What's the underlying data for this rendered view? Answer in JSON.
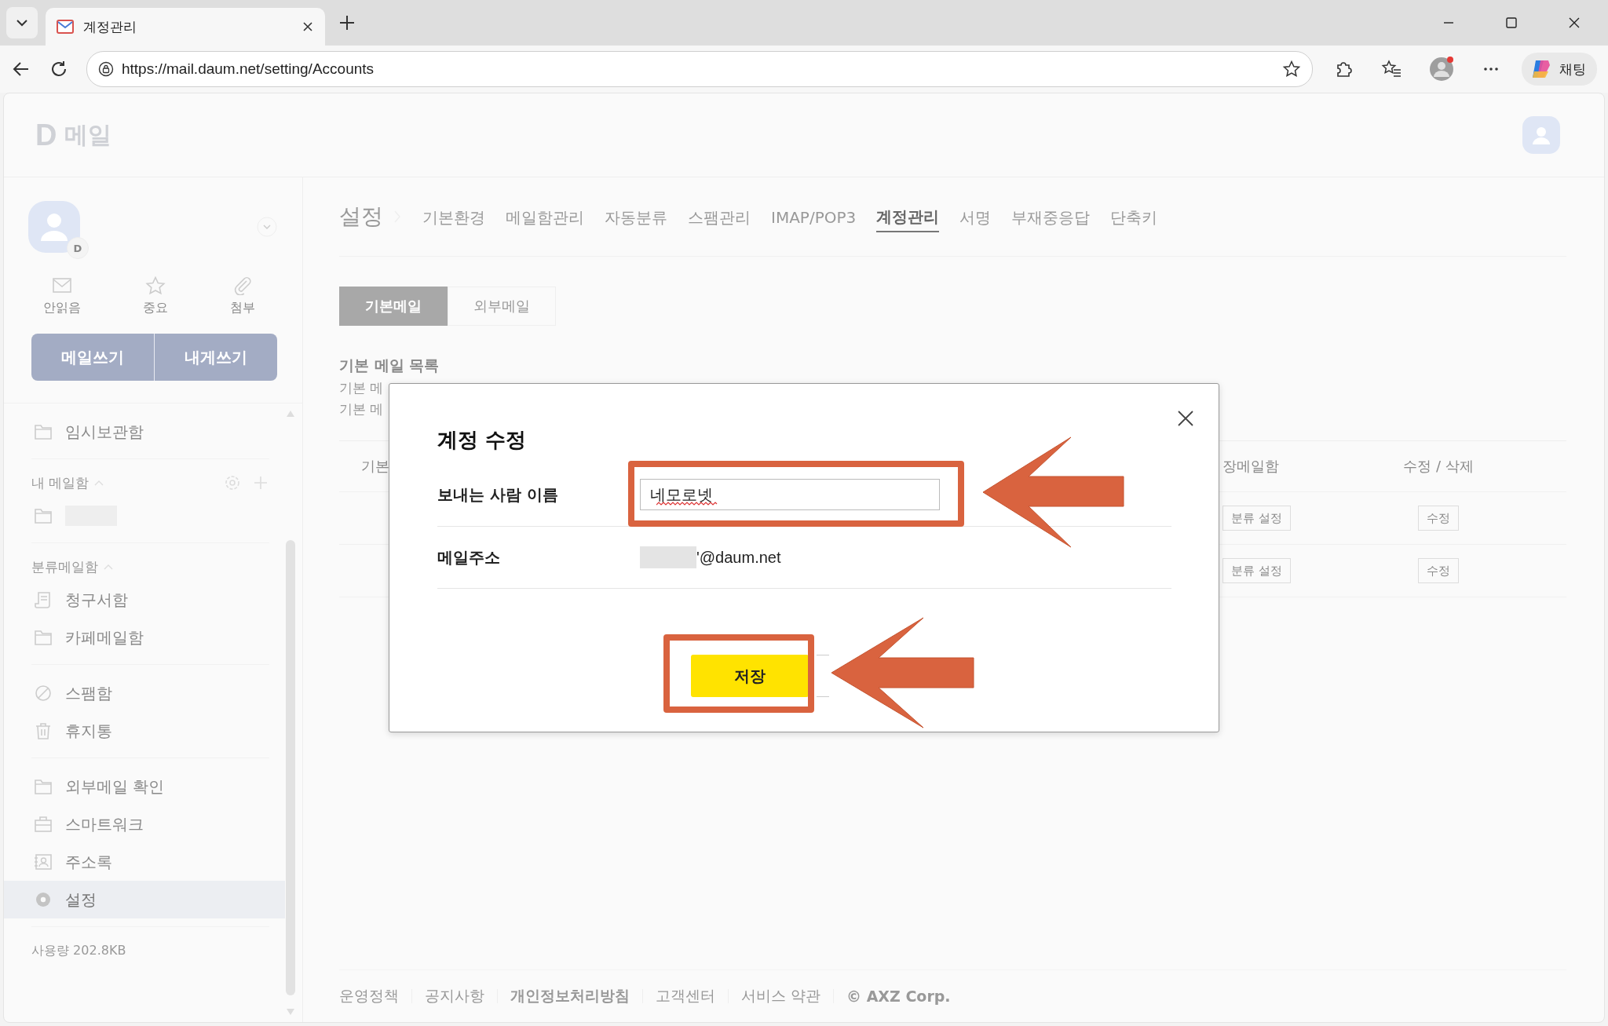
{
  "browser": {
    "tab_title": "계정관리",
    "url": "https://mail.daum.net/setting/Accounts",
    "chat_label": "채팅"
  },
  "header": {
    "logo_letter": "D",
    "logo_text": "메일"
  },
  "sidebar": {
    "avatar_badge": "D",
    "quick": [
      {
        "label": "안읽음"
      },
      {
        "label": "중요"
      },
      {
        "label": "첨부"
      }
    ],
    "compose": [
      "메일쓰기",
      "내게쓰기"
    ],
    "groups": [
      {
        "items": [
          {
            "label": "임시보관함",
            "selected": false
          }
        ]
      },
      {
        "title": "내 메일함",
        "items": [
          {
            "redacted": true,
            "selected": false
          }
        ]
      },
      {
        "title": "분류메일함",
        "items": [
          {
            "label": "청구서함",
            "selected": false
          },
          {
            "label": "카페메일함",
            "selected": false
          }
        ]
      },
      {
        "items": [
          {
            "label": "스팸함",
            "selected": false
          },
          {
            "label": "휴지통",
            "selected": false
          }
        ]
      },
      {
        "items": [
          {
            "label": "외부메일 확인",
            "selected": false
          },
          {
            "label": "스마트워크",
            "selected": false
          },
          {
            "label": "주소록",
            "selected": false
          },
          {
            "label": "설정",
            "selected": true
          }
        ]
      }
    ],
    "usage": "사용량 202.8KB"
  },
  "settings": {
    "title": "설정",
    "tabs": [
      {
        "label": "기본환경",
        "selected": false
      },
      {
        "label": "메일함관리",
        "selected": false
      },
      {
        "label": "자동분류",
        "selected": false
      },
      {
        "label": "스팸관리",
        "selected": false
      },
      {
        "label": "IMAP/POP3",
        "selected": false
      },
      {
        "label": "계정관리",
        "selected": true
      },
      {
        "label": "서명",
        "selected": false
      },
      {
        "label": "부재중응답",
        "selected": false
      },
      {
        "label": "단축키",
        "selected": false
      }
    ],
    "subtabs": [
      {
        "label": "기본메일",
        "selected": true
      },
      {
        "label": "외부메일",
        "selected": false
      }
    ],
    "section_title": "기본 메일 목록",
    "description": [
      "기본 메",
      "기본 메"
    ],
    "table": {
      "columns": [
        "기본",
        "장메일함",
        "수정 / 삭제"
      ],
      "rows": [
        {
          "filter": "분류 설정",
          "edit": "수정"
        },
        {
          "filter": "분류 설정",
          "edit": "수정"
        }
      ]
    }
  },
  "dialog": {
    "title": "계정 수정",
    "fields": [
      {
        "kind": "input",
        "label": "보내는 사람 이름",
        "value": "네모로넷"
      },
      {
        "kind": "email",
        "label": "메일주소",
        "value": "'@daum.net",
        "redacted": true
      }
    ],
    "save": "저장"
  },
  "footer": [
    {
      "label": "운영정책",
      "bold": false
    },
    {
      "label": "공지사항",
      "bold": false
    },
    {
      "label": "개인정보처리방침",
      "bold": true
    },
    {
      "label": "고객센터",
      "bold": false
    },
    {
      "label": "서비스 약관",
      "bold": false
    },
    {
      "label": "© AXZ Corp.",
      "bold": true
    }
  ]
}
